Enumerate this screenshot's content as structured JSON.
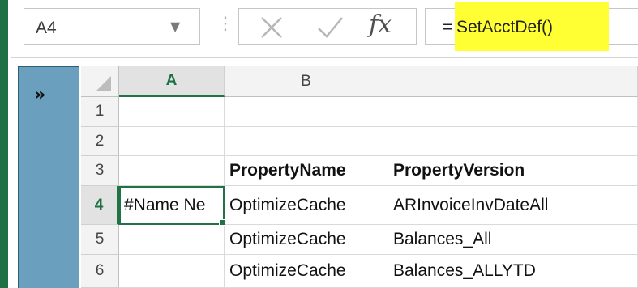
{
  "name_box": {
    "value": "A4"
  },
  "formula_bar": {
    "equals": "=",
    "formula": "SetAcctDef()",
    "fx_label": "fx",
    "highlight_color": "#ffff33"
  },
  "pane_toggle": "»",
  "columns": [
    {
      "label": "A",
      "active": true
    },
    {
      "label": "B",
      "active": false
    },
    {
      "label": "",
      "active": false
    }
  ],
  "rows": [
    {
      "num": "1",
      "a": "",
      "b": "",
      "c": ""
    },
    {
      "num": "2",
      "a": "",
      "b": "",
      "c": ""
    },
    {
      "num": "3",
      "a": "",
      "b": "PropertyName",
      "c": "PropertyVersion"
    },
    {
      "num": "4",
      "a": "#Name Ne",
      "b": "OptimizeCache",
      "c": "ARInvoiceInvDateAll"
    },
    {
      "num": "5",
      "a": "",
      "b": "OptimizeCache",
      "c": "Balances_All"
    },
    {
      "num": "6",
      "a": "",
      "b": "OptimizeCache",
      "c": "Balances_ALLYTD"
    }
  ],
  "active_cell": "A4",
  "colors": {
    "excel_green": "#217346",
    "pane_blue": "#6a9fbe"
  }
}
